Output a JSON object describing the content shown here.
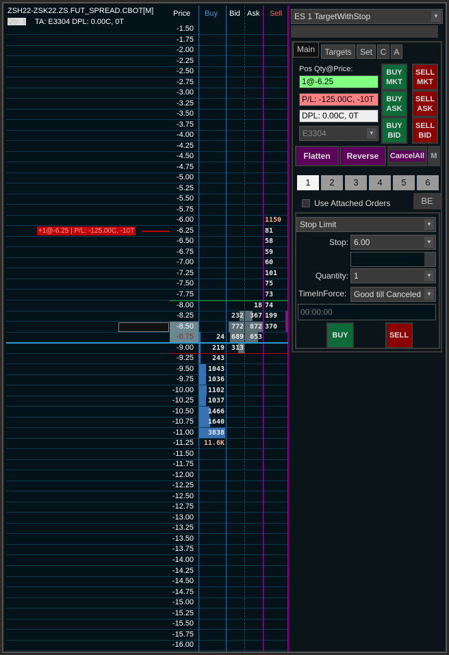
{
  "header": {
    "symbol": "ZSH22-ZSK22.ZS.FUT_SPREAD.CBOT[M]",
    "qty_label": "Qty: 1",
    "account_info": "TA: E3304  DPL: 0.00C, 0T",
    "columns": {
      "price": "Price",
      "buy": "Buy",
      "bid": "Bid",
      "ask": "Ask",
      "sell": "Sell"
    }
  },
  "colors": {
    "buy": "#3a78c0",
    "sell": "#e06060",
    "position": "#c00000",
    "green_line": "#1aa01a",
    "magenta": "#a000a0"
  },
  "position_marker": "+1@-6.25 | P/L: -125.00C, -10T",
  "ladder": {
    "rows": [
      {
        "price": "-1.50"
      },
      {
        "price": "-1.75"
      },
      {
        "price": "-2.00"
      },
      {
        "price": "-2.25"
      },
      {
        "price": "-2.50"
      },
      {
        "price": "-2.75"
      },
      {
        "price": "-3.00"
      },
      {
        "price": "-3.25"
      },
      {
        "price": "-3.50"
      },
      {
        "price": "-3.75"
      },
      {
        "price": "-4.00"
      },
      {
        "price": "-4.25"
      },
      {
        "price": "-4.50"
      },
      {
        "price": "-4.75"
      },
      {
        "price": "-5.00"
      },
      {
        "price": "-5.25"
      },
      {
        "price": "-5.50"
      },
      {
        "price": "-5.75"
      },
      {
        "price": "-6.00",
        "sell": "1150"
      },
      {
        "price": "-6.25",
        "sell": "81"
      },
      {
        "price": "-6.50",
        "sell": "58"
      },
      {
        "price": "-6.75",
        "sell": "59"
      },
      {
        "price": "-7.00",
        "sell": "60"
      },
      {
        "price": "-7.25",
        "sell": "101"
      },
      {
        "price": "-7.50",
        "sell": "75"
      },
      {
        "price": "-7.75",
        "sell": "73"
      },
      {
        "price": "-8.00",
        "ask": "18",
        "sell": "74"
      },
      {
        "price": "-8.25",
        "bid": "232",
        "ask": "367",
        "sell": "199"
      },
      {
        "price": "-8.50",
        "bid": "772",
        "ask": "872",
        "sell": "370"
      },
      {
        "price": "-8.75",
        "buy": "24",
        "bid": "689",
        "ask": "653"
      },
      {
        "price": "-9.00",
        "buy": "219",
        "bid": "313"
      },
      {
        "price": "-9.25",
        "buy": "243"
      },
      {
        "price": "-9.50",
        "buy": "1043"
      },
      {
        "price": "-9.75",
        "buy": "1036"
      },
      {
        "price": "-10.00",
        "buy": "1102"
      },
      {
        "price": "-10.25",
        "buy": "1037"
      },
      {
        "price": "-10.50",
        "buy": "1466"
      },
      {
        "price": "-10.75",
        "buy": "1640"
      },
      {
        "price": "-11.00",
        "buy": "3838"
      },
      {
        "price": "-11.25",
        "buy": "11.6K"
      },
      {
        "price": "-11.50"
      },
      {
        "price": "-11.75"
      },
      {
        "price": "-12.00"
      },
      {
        "price": "-12.25"
      },
      {
        "price": "-12.50"
      },
      {
        "price": "-12.75"
      },
      {
        "price": "-13.00"
      },
      {
        "price": "-13.25"
      },
      {
        "price": "-13.50"
      },
      {
        "price": "-13.75"
      },
      {
        "price": "-14.00"
      },
      {
        "price": "-14.25"
      },
      {
        "price": "-14.50"
      },
      {
        "price": "-14.75"
      },
      {
        "price": "-15.00"
      },
      {
        "price": "-15.25"
      },
      {
        "price": "-15.50"
      },
      {
        "price": "-15.75"
      },
      {
        "price": "-16.00"
      }
    ]
  },
  "panel": {
    "strategy": "ES 1 TargetWithStop",
    "tabs": [
      "Main",
      "Targets",
      "Set",
      "C",
      "A"
    ],
    "pos_label": "Pos Qty@Price:",
    "pos_value": "1@-6.25",
    "pl_value": "P/L: -125.00C, -10T",
    "dpl_value": "DPL: 0.00C, 0T",
    "account": "E3304",
    "buy_mkt": "BUY MKT",
    "sell_mkt": "SELL MKT",
    "buy_ask": "BUY ASK",
    "sell_ask": "SELL ASK",
    "buy_bid": "BUY BID",
    "sell_bid": "SELL BID",
    "flatten": "Flatten",
    "reverse": "Reverse",
    "cancel_all": "CancelAll",
    "m": "M",
    "numbers": [
      "1",
      "2",
      "3",
      "4",
      "5",
      "6"
    ],
    "use_attached": "Use Attached Orders",
    "be": "BE",
    "order_type": "Stop Limit",
    "stop_label": "Stop:",
    "stop_value": "6.00",
    "quantity_label": "Quantity:",
    "quantity_value": "1",
    "tif_label": "TimeInForce:",
    "tif_value": "Good till Canceled",
    "time_value": "00:00:00",
    "buy": "BUY",
    "sell": "SELL"
  }
}
